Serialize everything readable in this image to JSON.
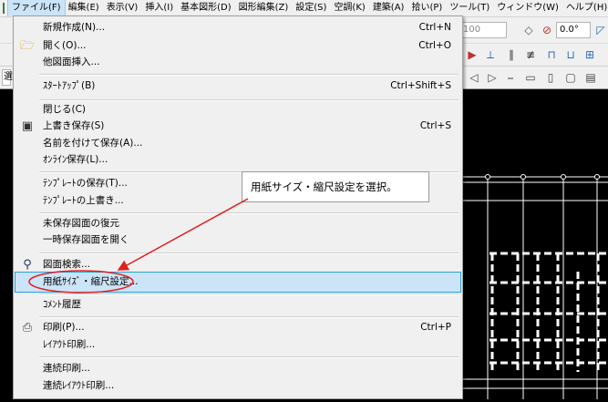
{
  "menubar": {
    "items": [
      "ファイル(F)",
      "編集(E)",
      "表示(V)",
      "挿入(I)",
      "基本図形(D)",
      "図形編集(Z)",
      "設定(S)",
      "空調(K)",
      "建築(A)",
      "拾い(P)",
      "ツール(T)",
      "ウィンドウ(W)",
      "ヘルプ(H)"
    ]
  },
  "toolbar": {
    "scale_value": "100",
    "angle_value": "0.0°",
    "left_field": "選"
  },
  "file_menu": {
    "new": {
      "label": "新規作成(N)...",
      "shortcut": "Ctrl+N"
    },
    "open": {
      "label": "開く(O)...",
      "shortcut": "Ctrl+O"
    },
    "insert_other": {
      "label": "他図面挿入..."
    },
    "startup": {
      "label": "ｽﾀｰﾄｱｯﾌﾟ(B)",
      "shortcut": "Ctrl+Shift+S"
    },
    "close": {
      "label": "閉じる(C)"
    },
    "save": {
      "label": "上書き保存(S)",
      "shortcut": "Ctrl+S"
    },
    "save_as": {
      "label": "名前を付けて保存(A)..."
    },
    "online_save": {
      "label": "ｵﾝﾗｲﾝ保存(L)..."
    },
    "template_save": {
      "label": "ﾃﾝﾌﾟﾚｰﾄの保存(T)..."
    },
    "template_overwrite": {
      "label": "ﾃﾝﾌﾟﾚｰﾄの上書き..."
    },
    "restore_unsaved": {
      "label": "未保存図面の復元"
    },
    "open_temp": {
      "label": "一時保存図面を開く"
    },
    "drawing_search": {
      "label": "図面検索..."
    },
    "paper_size": {
      "label": "用紙ｻｲｽﾞ・縮尺設定..."
    },
    "comment_history": {
      "label": "ｺﾒﾝﾄ履歴"
    },
    "print": {
      "label": "印刷(P)...",
      "shortcut": "Ctrl+P"
    },
    "layout_print": {
      "label": "ﾚｲｱｳﾄ印刷..."
    },
    "continuous_print": {
      "label": "連続印刷..."
    },
    "continuous_layout_print": {
      "label": "連続ﾚｲｱｳﾄ印刷..."
    }
  },
  "callout": {
    "text": "用紙サイズ・縮尺設定を選択。"
  },
  "colors": {
    "highlight": "#cce4f7",
    "annotation": "#e02020",
    "cad_lines": "#ffffff"
  }
}
